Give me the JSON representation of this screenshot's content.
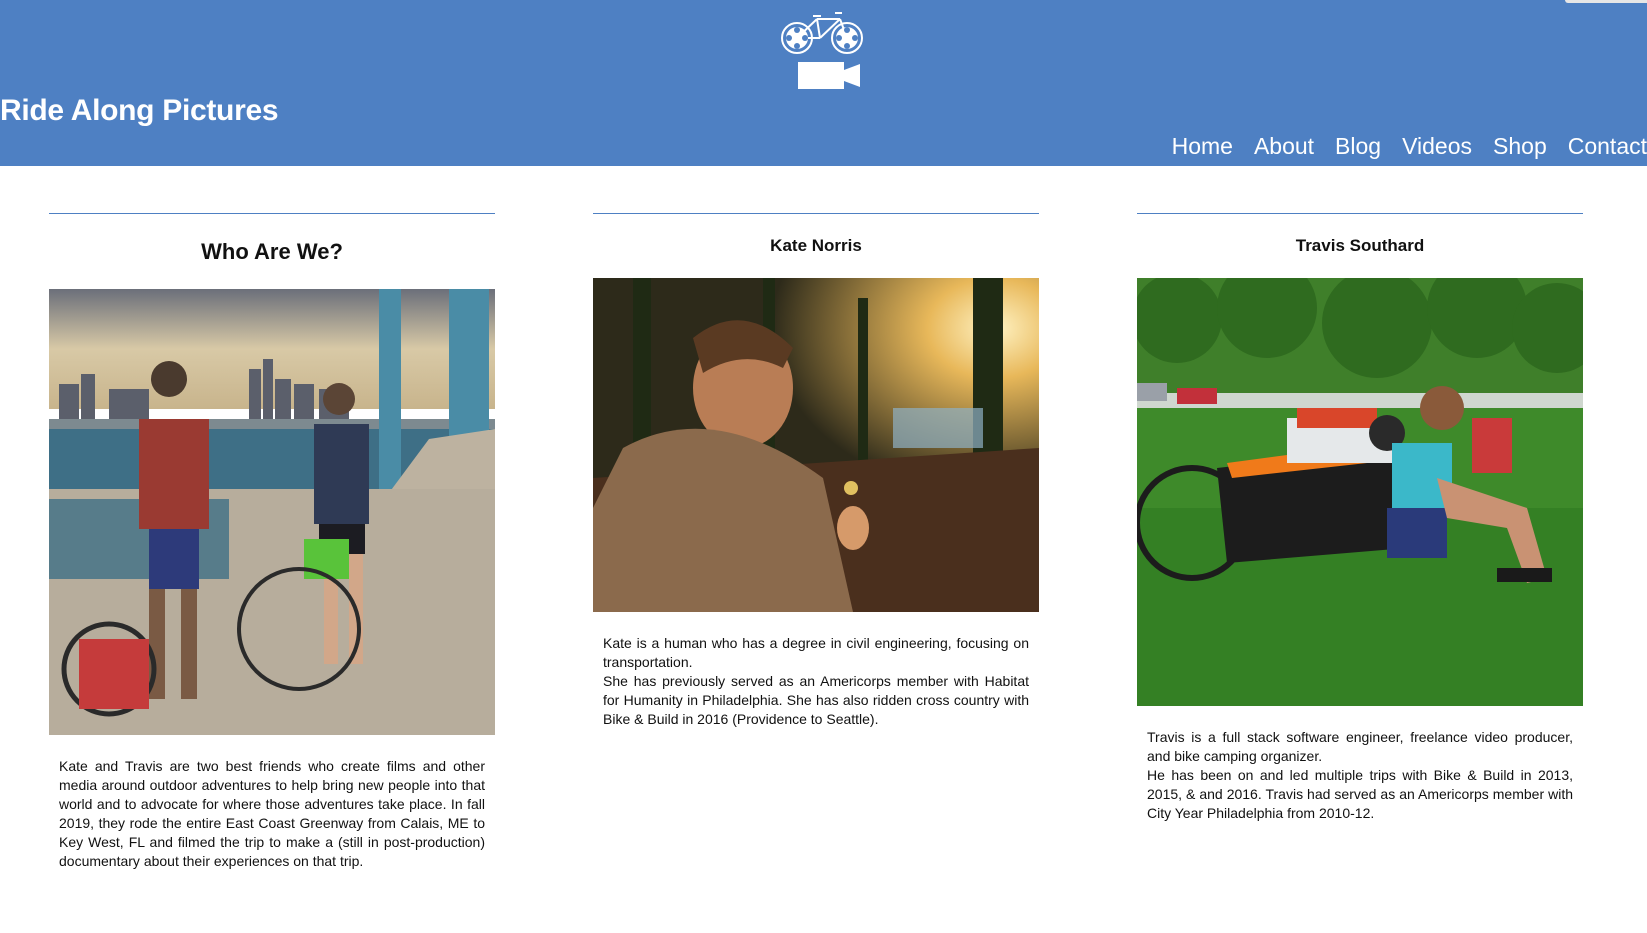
{
  "header": {
    "site_title": "Ride Along Pictures",
    "logo_icon": "bicycle-film-camera-icon",
    "nav": [
      "Home",
      "About",
      "Blog",
      "Videos",
      "Shop",
      "Contact"
    ]
  },
  "columns": [
    {
      "heading": "Who Are We?",
      "photo_icon": "two-cyclists-on-bridge-photo",
      "paragraphs": [
        "Kate and Travis are two best friends who create films and other media around outdoor adventures to help bring new people into that world and to advocate for where those adventures take place. In fall 2019, they rode the entire East Coast Greenway from Calais, ME to Key West, FL and filmed the trip to make a (still in post-production) documentary about their experiences on that trip."
      ]
    },
    {
      "heading": "Kate Norris",
      "photo_icon": "kate-at-sunset-photo",
      "paragraphs": [
        "Kate is a human who has a degree in civil engineering, focusing on transportation.",
        "She has previously served as an Americorps member with Habitat for Humanity in Philadelphia. She has also ridden cross country with Bike & Build in 2016 (Providence to Seattle)."
      ]
    },
    {
      "heading": "Travis Southard",
      "photo_icon": "travis-with-cargo-bike-photo",
      "paragraphs": [
        "Travis is a full stack software engineer, freelance video producer, and bike camping organizer.",
        "He has been on and led multiple trips with Bike & Build in 2013, 2015, & and 2016. Travis had served as an Americorps member with City Year Philadelphia from 2010-12."
      ]
    }
  ],
  "colors": {
    "header_bg": "#4e80c3",
    "rule": "#4e80c3",
    "text": "#111111"
  }
}
